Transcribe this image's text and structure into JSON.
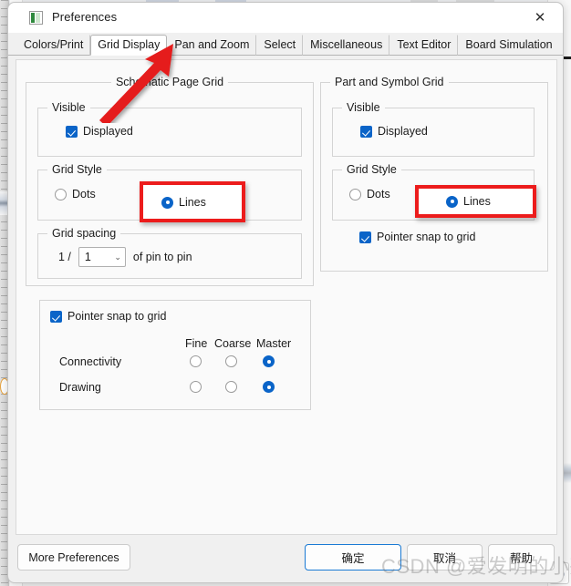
{
  "window": {
    "title": "Preferences",
    "icon": "preferences-icon",
    "close_label": "✕"
  },
  "tabs": [
    {
      "label": "Colors/Print",
      "active": false
    },
    {
      "label": "Grid Display",
      "active": true
    },
    {
      "label": "Pan and Zoom",
      "active": false
    },
    {
      "label": "Select",
      "active": false
    },
    {
      "label": "Miscellaneous",
      "active": false
    },
    {
      "label": "Text Editor",
      "active": false
    },
    {
      "label": "Board Simulation",
      "active": false
    }
  ],
  "schematic_page_grid": {
    "title": "Schematic Page Grid",
    "visible": {
      "title": "Visible",
      "displayed_label": "Displayed",
      "displayed_checked": true
    },
    "grid_style": {
      "title": "Grid Style",
      "dots_label": "Dots",
      "dots_selected": false,
      "lines_label": "Lines",
      "lines_selected": true
    },
    "grid_spacing": {
      "title": "Grid spacing",
      "prefix": "1 /",
      "value": "1",
      "suffix": "of pin to pin",
      "chevron": "⌄"
    }
  },
  "pointer_snap": {
    "title": "Pointer snap to grid",
    "checked": true,
    "columns": [
      "Fine",
      "Coarse",
      "Master"
    ],
    "rows": [
      {
        "label": "Connectivity",
        "selected": "Master"
      },
      {
        "label": "Drawing",
        "selected": "Master"
      }
    ]
  },
  "part_and_symbol_grid": {
    "title": "Part and Symbol Grid",
    "visible": {
      "title": "Visible",
      "displayed_label": "Displayed",
      "displayed_checked": true
    },
    "grid_style": {
      "title": "Grid Style",
      "dots_label": "Dots",
      "dots_selected": false,
      "lines_label": "Lines",
      "lines_selected": true
    },
    "pointer_snap_label": "Pointer snap to grid",
    "pointer_snap_checked": true
  },
  "footer": {
    "more_preferences": "More Preferences",
    "ok": "确定",
    "cancel": "取消",
    "help": "帮助"
  },
  "annotations": {
    "watermark": "CSDN @爱发明的小兴",
    "highlight_color": "#ec1c1c",
    "arrow_color": "#e51b1b",
    "accent_color": "#0a64c8",
    "focus_color": "#1a7ad4"
  }
}
